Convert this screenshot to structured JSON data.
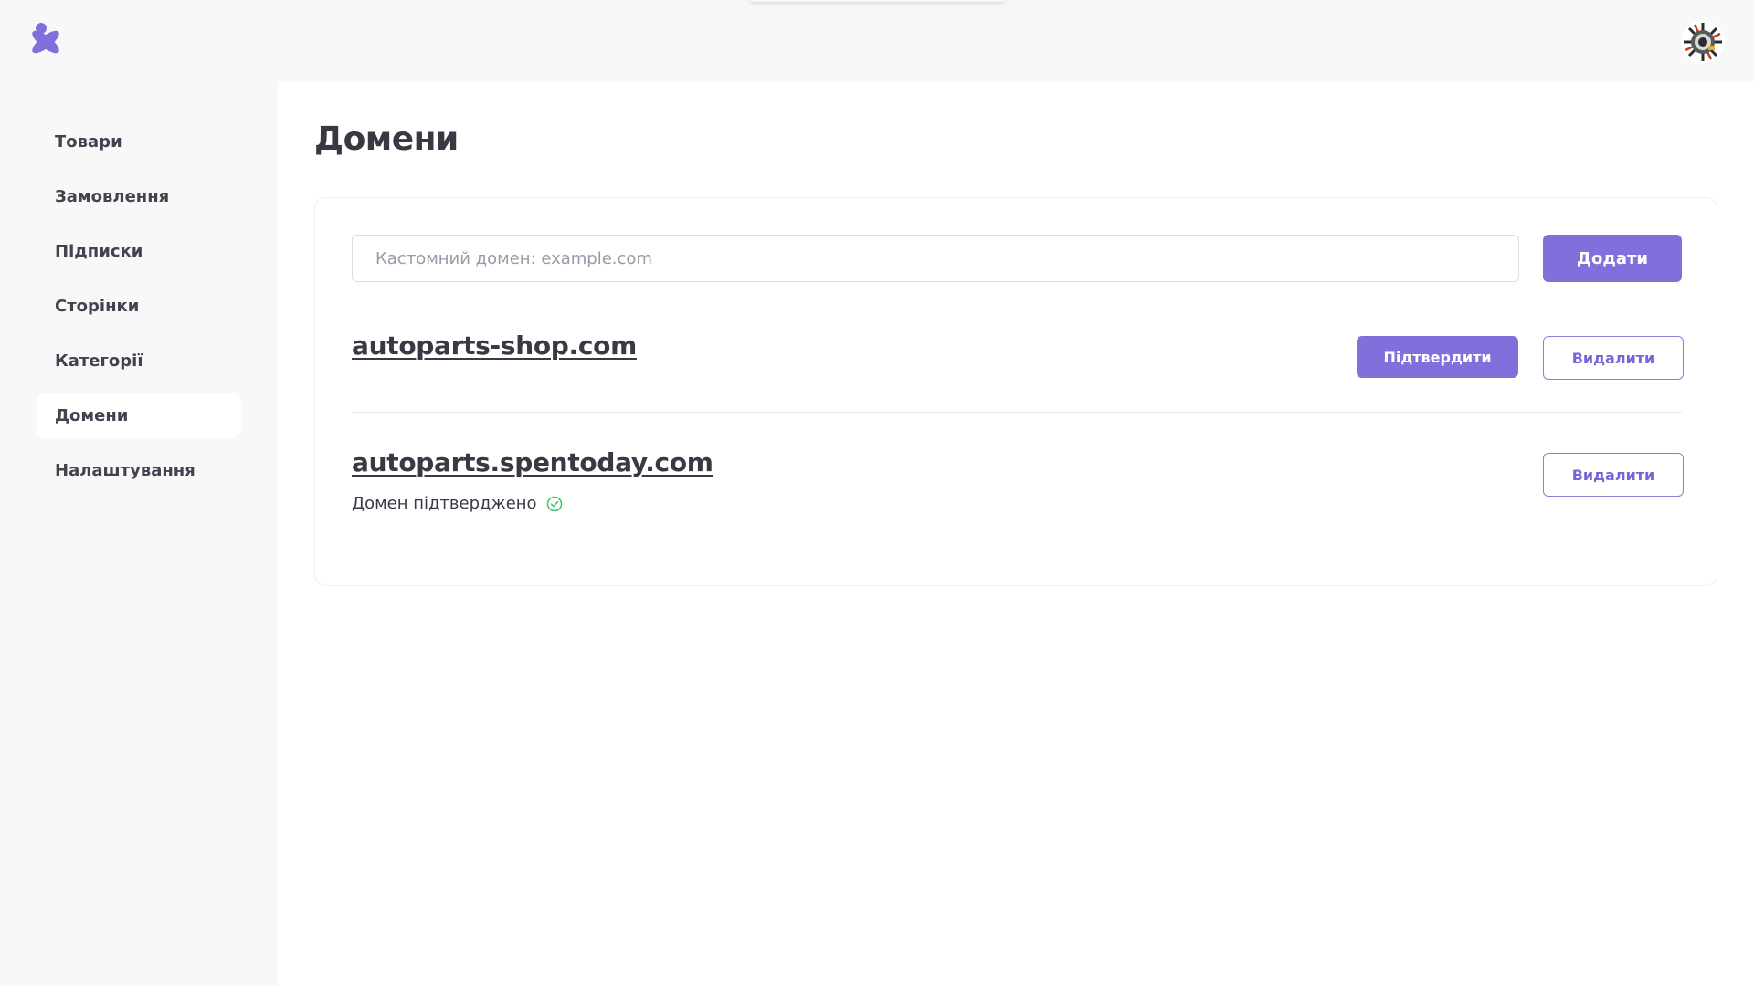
{
  "header": {
    "logo_icon": "asterisk-logo-icon",
    "avatar_icon": "gear-avatar-icon"
  },
  "sidebar": {
    "items": [
      {
        "label": "Товари"
      },
      {
        "label": "Замовлення"
      },
      {
        "label": "Підписки"
      },
      {
        "label": "Сторінки"
      },
      {
        "label": "Категорії"
      },
      {
        "label": "Домени",
        "active": true
      },
      {
        "label": "Налаштування"
      }
    ]
  },
  "main": {
    "title": "Домени",
    "domain_input": {
      "placeholder": "Кастомний домен: example.com",
      "value": ""
    },
    "add_label": "Додати",
    "domains": [
      {
        "name": "autoparts-shop.com",
        "confirm_label": "Підтвердити",
        "delete_label": "Видалити"
      },
      {
        "name": "autoparts.spentoday.com",
        "status_text": "Домен підтверджено",
        "status_icon": "check-circle-icon",
        "delete_label": "Видалити"
      }
    ]
  },
  "colors": {
    "accent": "#8070dc",
    "success": "#3cc46a",
    "sidebar_bg": "#f8f8f9",
    "content_bg": "#ffffff"
  }
}
